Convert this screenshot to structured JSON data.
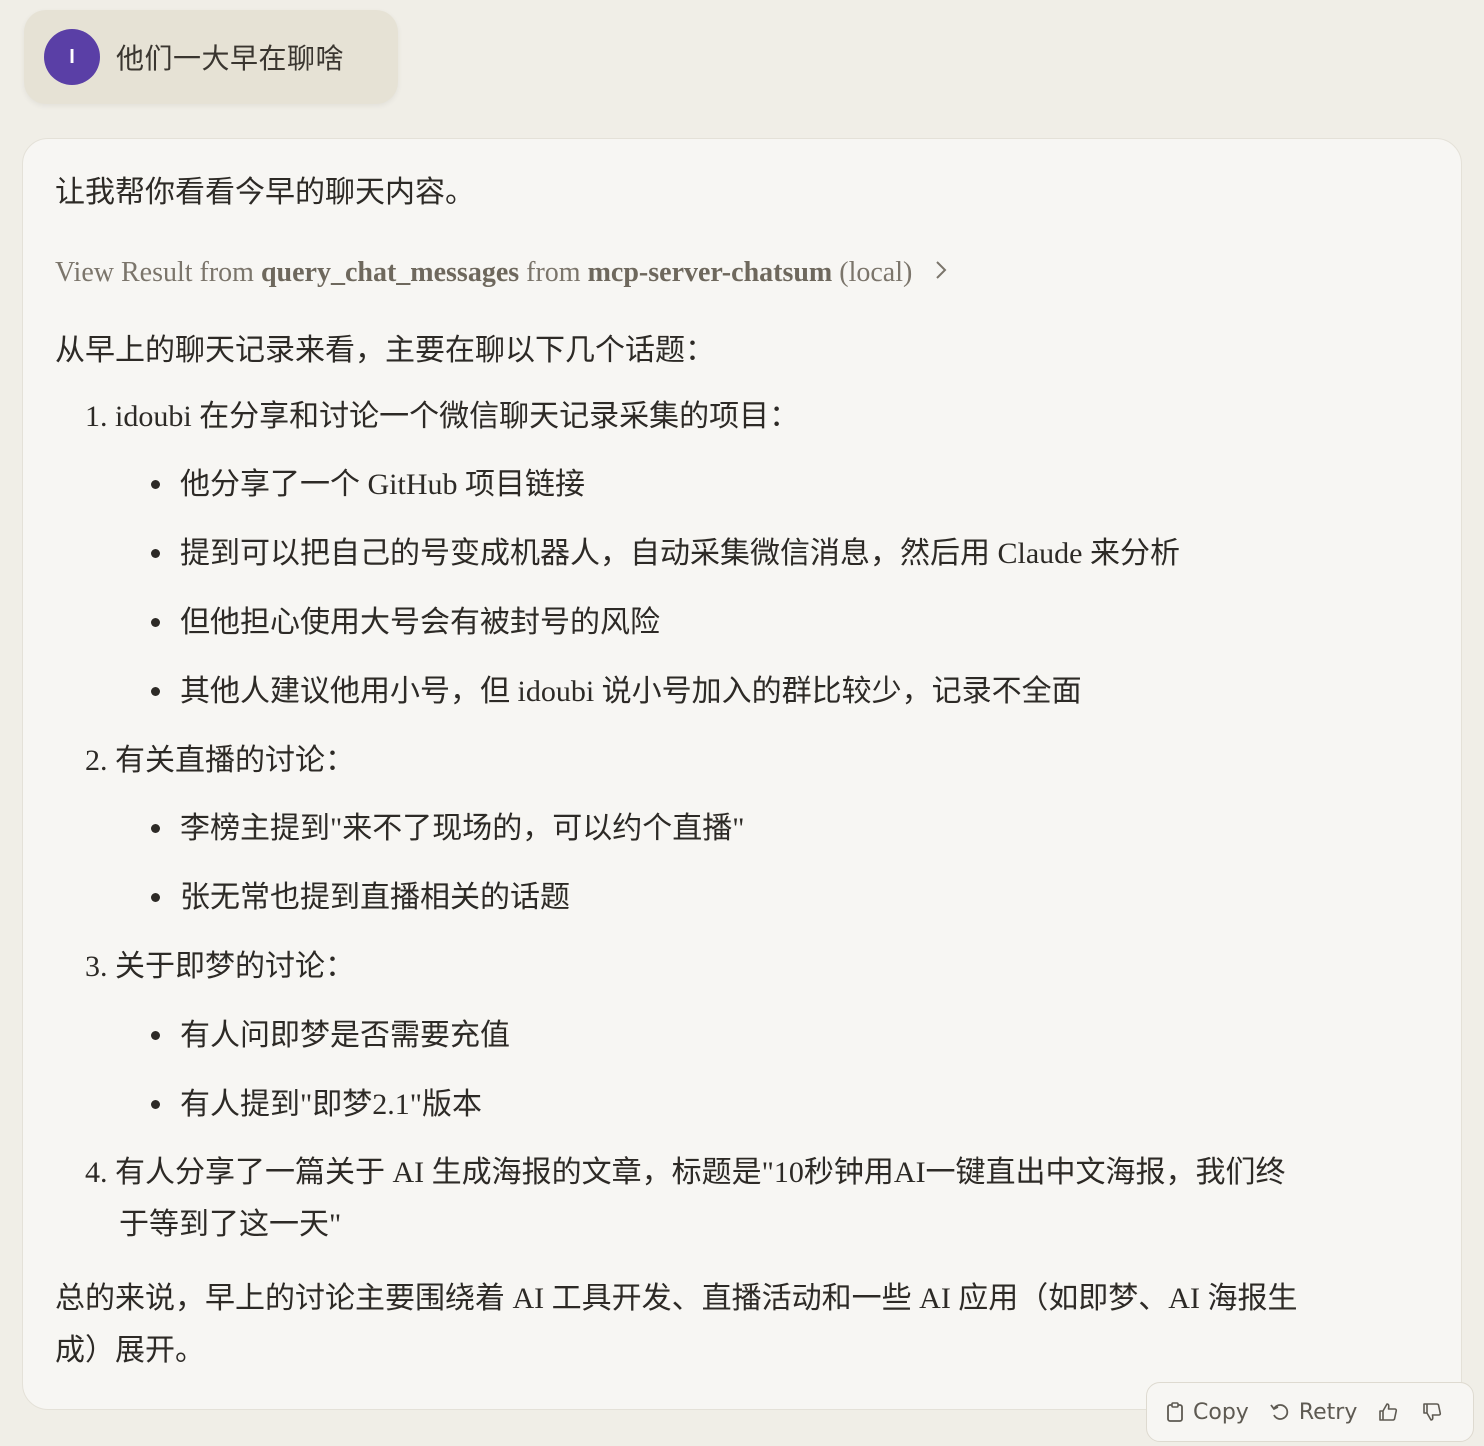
{
  "user_message": {
    "avatar_initial": "I",
    "text": "他们一大早在聊啥"
  },
  "assistant": {
    "intro": "让我帮你看看今早的聊天内容。",
    "tool_result": {
      "prefix": "View Result from ",
      "tool": "query_chat_messages",
      "middle": " from ",
      "server": "mcp-server-chatsum",
      "suffix": " (local)"
    },
    "lead": "从早上的聊天记录来看，主要在聊以下几个话题：",
    "topics": [
      {
        "number": "1.",
        "title": "idoubi 在分享和讨论一个微信聊天记录采集的项目：",
        "bullets": [
          "他分享了一个 GitHub 项目链接",
          "提到可以把自己的号变成机器人，自动采集微信消息，然后用 Claude 来分析",
          "但他担心使用大号会有被封号的风险",
          "其他人建议他用小号，但 idoubi 说小号加入的群比较少，记录不全面"
        ]
      },
      {
        "number": "2.",
        "title": "有关直播的讨论：",
        "bullets": [
          "李榜主提到\"来不了现场的，可以约个直播\"",
          "张无常也提到直播相关的话题"
        ]
      },
      {
        "number": "3.",
        "title": "关于即梦的讨论：",
        "bullets": [
          "有人问即梦是否需要充值",
          "有人提到\"即梦2.1\"版本"
        ]
      },
      {
        "number": "4.",
        "title_line1": "有人分享了一篇关于 AI 生成海报的文章，标题是\"10秒钟用AI一键直出中文海报，我们终",
        "title_line2": "于等到了这一天\""
      }
    ],
    "summary_line1": "总的来说，早上的讨论主要围绕着 AI 工具开发、直播活动和一些 AI 应用（如即梦、AI 海报生",
    "summary_line2": "成）展开。"
  },
  "actions": {
    "copy_label": "Copy",
    "retry_label": "Retry"
  }
}
